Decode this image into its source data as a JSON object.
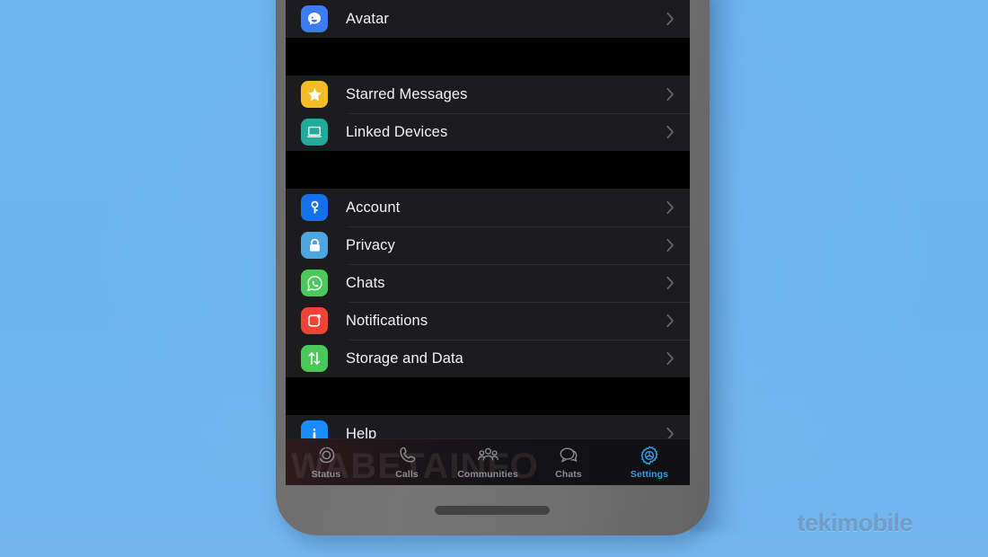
{
  "background": {
    "color": "#6cb3ee"
  },
  "device": {
    "frame_color": "#6f6f6f",
    "home_indicator": "home-indicator"
  },
  "screen": {
    "background": "#000000",
    "row_background": "#1c1c1e",
    "divider": "#2e2e31",
    "text_color": "#f2f2f4",
    "chevron_color": "#666668"
  },
  "settings": {
    "groups": [
      {
        "id": "group-profile",
        "rows": [
          {
            "label": "Avatar",
            "icon": "avatar-icon",
            "icon_bg": "#3b7dee",
            "chevron": "chevron-right-icon"
          }
        ]
      },
      {
        "id": "group-quick",
        "rows": [
          {
            "label": "Starred Messages",
            "icon": "star-icon",
            "icon_bg": "#f5bd25",
            "chevron": "chevron-right-icon"
          },
          {
            "label": "Linked Devices",
            "icon": "laptop-icon",
            "icon_bg": "#22aa9c",
            "chevron": "chevron-right-icon"
          }
        ]
      },
      {
        "id": "group-main",
        "rows": [
          {
            "label": "Account",
            "icon": "key-icon",
            "icon_bg": "#1471e8",
            "chevron": "chevron-right-icon"
          },
          {
            "label": "Privacy",
            "icon": "lock-icon",
            "icon_bg": "#4da6dd",
            "chevron": "chevron-right-icon"
          },
          {
            "label": "Chats",
            "icon": "whatsapp-chat-icon",
            "icon_bg": "#4bc85a",
            "chevron": "chevron-right-icon"
          },
          {
            "label": "Notifications",
            "icon": "notification-bell-icon",
            "icon_bg": "#ee4337",
            "chevron": "chevron-right-icon"
          },
          {
            "label": "Storage and Data",
            "icon": "arrows-updown-icon",
            "icon_bg": "#4bc85a",
            "chevron": "chevron-right-icon"
          }
        ]
      },
      {
        "id": "group-help",
        "rows": [
          {
            "label": "Help",
            "icon": "info-icon",
            "icon_bg": "#1a8cff",
            "chevron": "chevron-right-icon"
          }
        ]
      }
    ]
  },
  "tabbar": {
    "active_color": "#2f9fe8",
    "inactive_color": "#8d8d92",
    "tabs": [
      {
        "label": "Status",
        "icon": "status-rings-icon",
        "active": false
      },
      {
        "label": "Calls",
        "icon": "phone-icon",
        "active": false
      },
      {
        "label": "Communities",
        "icon": "communities-people-icon",
        "active": false
      },
      {
        "label": "Chats",
        "icon": "chat-bubbles-icon",
        "active": false
      },
      {
        "label": "Settings",
        "icon": "gear-icon",
        "active": true
      }
    ]
  },
  "watermarks": {
    "overlay_text": "WABETAINFO",
    "corner_text": "tekimobile"
  }
}
